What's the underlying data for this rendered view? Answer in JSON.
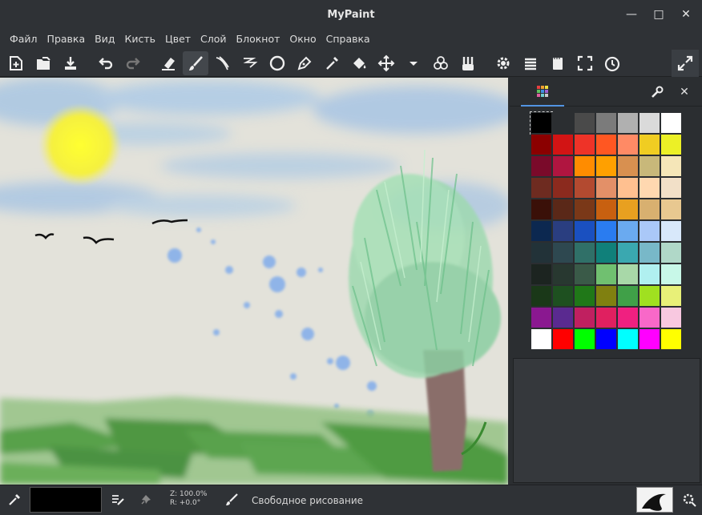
{
  "window": {
    "title": "MyPaint",
    "controls": [
      "minimize-icon",
      "maximize-icon",
      "close-icon"
    ]
  },
  "menu": [
    "Файл",
    "Правка",
    "Вид",
    "Кисть",
    "Цвет",
    "Слой",
    "Блокнот",
    "Окно",
    "Справка"
  ],
  "toolbar": {
    "icons": [
      "new-document-icon",
      "open-icon",
      "save-icon",
      "undo-icon",
      "redo-icon",
      "eraser-icon",
      "brush-icon",
      "inking-icon",
      "line-icon",
      "ellipse-icon",
      "pen-icon",
      "color-picker-icon",
      "fill-icon",
      "move-icon",
      "dropdown-icon",
      "color-circles-icon",
      "brushes-icon",
      "settings-icon",
      "layers-icon",
      "scratchpad-icon",
      "frame-icon",
      "history-icon",
      "fullscreen-icon"
    ],
    "active": "brush-icon"
  },
  "panel": {
    "tab": "palette-tab",
    "actions": [
      "wrench-icon",
      "close-icon"
    ]
  },
  "palette": {
    "colors": [
      [
        "#000000",
        "#2b2e31",
        "#4a4a4a",
        "#7b7b7b",
        "#b0b0b0",
        "#dadada",
        "#ffffff"
      ],
      [
        "#8b0000",
        "#d21414",
        "#ee3328",
        "#ff5722",
        "#ff8a65",
        "#f0cd22",
        "#ecf026"
      ],
      [
        "#7a0a2a",
        "#b01540",
        "#ff8c00",
        "#ffa000",
        "#d89050",
        "#c8b87a",
        "#f5e6b8"
      ],
      [
        "#6e2b20",
        "#8b2a1e",
        "#b34a30",
        "#e39068",
        "#ffc090",
        "#ffd8b0",
        "#f2e0c8"
      ],
      [
        "#3a1008",
        "#5a2818",
        "#7a3818",
        "#c86010",
        "#e8a020",
        "#d8b070",
        "#e8c890"
      ],
      [
        "#0c2850",
        "#2a3e80",
        "#1a50c0",
        "#2a7cf0",
        "#6aaaf0",
        "#aac8f8",
        "#d8e8fa"
      ],
      [
        "#223238",
        "#2e4850",
        "#307068",
        "#10807a",
        "#3aa8b0",
        "#78b8c8",
        "#b0d8c8"
      ],
      [
        "#1c2420",
        "#283830",
        "#3a5a48",
        "#70c070",
        "#a8d8a8",
        "#b0f0f0",
        "#c8f8e8"
      ],
      [
        "#1a3818",
        "#1e5020",
        "#207818",
        "#808010",
        "#40a048",
        "#a0e020",
        "#e8f078"
      ],
      [
        "#8a1890",
        "#5a2a90",
        "#c02060",
        "#e02060",
        "#f02080",
        "#f868c8",
        "#f8c8e0"
      ],
      [
        "#ffffff",
        "#ff0000",
        "#00ff00",
        "#0000ff",
        "#00ffff",
        "#ff00ff",
        "#ffff00"
      ]
    ]
  },
  "status": {
    "color": "#000000",
    "zoom": "Z: 100.0%",
    "rotation": "R: +0.0°",
    "mode": "Свободное рисование",
    "icons": [
      "color-picker-icon",
      "brush-settings-icon",
      "pin-icon",
      "brush-icon",
      "preview-icon",
      "settings-icon"
    ]
  }
}
